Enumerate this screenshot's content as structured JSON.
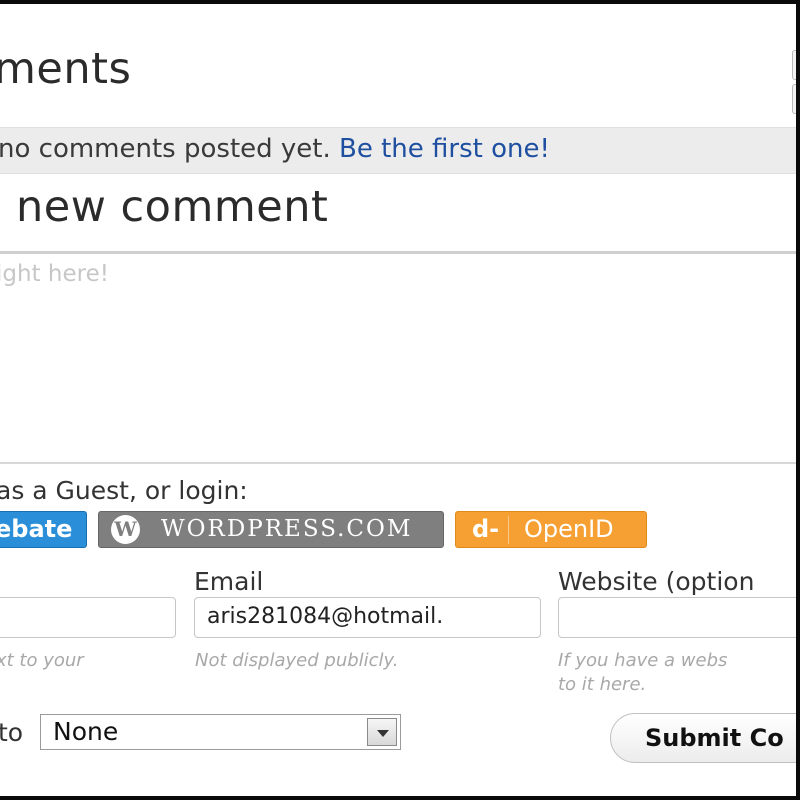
{
  "header": {
    "title": "ments"
  },
  "notice": {
    "text": "no comments posted yet. ",
    "link": "Be the first one!"
  },
  "compose": {
    "title": "new comment",
    "placeholder": "ight here!"
  },
  "login": {
    "prompt": "as a Guest, or login:",
    "buttons": [
      {
        "label": "ebate",
        "color": "#2a8fd8"
      },
      {
        "label": "WORDPRESS.COM",
        "icon_text": "W",
        "color": "#7f7f7f"
      },
      {
        "label": "OpenID",
        "icon_text": "d-",
        "color": "#f6a033"
      }
    ]
  },
  "fields": {
    "name": {
      "value": "",
      "hint": "xt to your"
    },
    "email": {
      "label": "Email",
      "value": "aris281084@hotmail.",
      "hint": "Not displayed publicly."
    },
    "website": {
      "label": "Website (option",
      "value": "",
      "hint_line1": "If you have a webs",
      "hint_line2": "to it here."
    }
  },
  "subscribe": {
    "label": "to",
    "selected": "None"
  },
  "submit": {
    "label": "Submit Co"
  }
}
